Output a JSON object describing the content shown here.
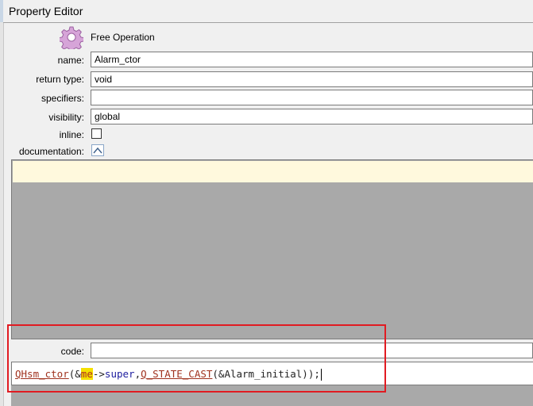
{
  "window": {
    "title": "Property Editor"
  },
  "header": {
    "kind": "Free Operation",
    "icon": "gear-icon"
  },
  "fields": {
    "name": {
      "label": "name:",
      "value": "Alarm_ctor"
    },
    "return_type": {
      "label": "return type:",
      "value": "void"
    },
    "specifiers": {
      "label": "specifiers:",
      "value": ""
    },
    "visibility": {
      "label": "visibility:",
      "value": "global"
    },
    "inline": {
      "label": "inline:",
      "checked": false
    },
    "documentation": {
      "label": "documentation:",
      "value": ""
    },
    "code": {
      "label": "code:",
      "value": ""
    }
  },
  "code_editor": {
    "tokens": [
      {
        "text": "QHsm_ctor",
        "kind": "call"
      },
      {
        "text": "(&",
        "kind": "plain"
      },
      {
        "text": "me",
        "kind": "kw"
      },
      {
        "text": "->",
        "kind": "plain"
      },
      {
        "text": "super",
        "kind": "member"
      },
      {
        "text": ",",
        "kind": "plain"
      },
      {
        "text": "Q_STATE_CAST",
        "kind": "call"
      },
      {
        "text": "(&Alarm_initial));",
        "kind": "plain"
      }
    ]
  },
  "colors": {
    "highlight_box": "#e11b22",
    "doc_line": "#fff9dd",
    "editor_background": "#a9a9a9",
    "keyword_highlight": "#f5e000"
  }
}
